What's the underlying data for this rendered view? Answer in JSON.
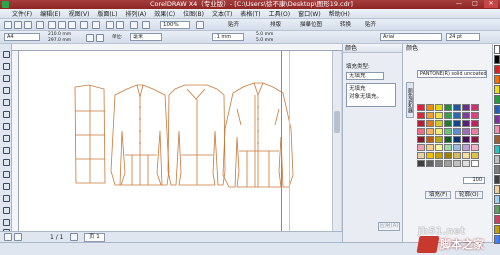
{
  "window": {
    "title": "CorelDRAW X4（专业版）- [C:\\Users\\徐不康\\Desktop\\图形19.cdr]",
    "controls": [
      "—",
      "□",
      "✕"
    ]
  },
  "menu": [
    "文件(F)",
    "编辑(E)",
    "视图(V)",
    "版面(L)",
    "排列(A)",
    "效果(C)",
    "位图(B)",
    "文本(T)",
    "表格(T)",
    "工具(O)",
    "窗口(W)",
    "帮助(H)"
  ],
  "toolbar": {
    "zoom": "100%",
    "snap_label": "贴齐",
    "options_label": "排版",
    "transform_label": "转换",
    "trace_label": "描摹位图",
    "paste_label": "贴齐"
  },
  "property_bar": {
    "page_size": "A4",
    "width": "210.0 mm",
    "height": "297.0 mm",
    "units_label": "单位:",
    "units": "毫米",
    "nudge": ".1 mm",
    "dup_x": "5.0 mm",
    "dup_y": "5.0 mm",
    "font": "Arial",
    "font_size": "24 pt"
  },
  "statusbar": {
    "page_counter": "1 / 1",
    "page_tab": "页 1"
  },
  "docker": {
    "title": "颜色",
    "fill_type_label": "填充类型:",
    "fill_type_value": "无填充",
    "info_lines": [
      "无填充",
      "对象无填充。"
    ],
    "apply_button": "应用(A)"
  },
  "color_panel": {
    "title": "颜色",
    "palette_select": "PANTONE(R) solid uncoated",
    "vertical_tab": "颜色调和器",
    "swatches": [
      "#e61e3c",
      "#f08a00",
      "#e8d800",
      "#2a8c3c",
      "#1a58a8",
      "#6a2e8c",
      "#d0306e",
      "#d8283c",
      "#f0a030",
      "#f0e040",
      "#3aa04c",
      "#2a68b8",
      "#7c3e9c",
      "#e0407e",
      "#b81e34",
      "#e07820",
      "#d8c820",
      "#1e7c34",
      "#0e4898",
      "#5a1e7c",
      "#c0205e",
      "#f06c84",
      "#f4b460",
      "#f4ec70",
      "#6cc47c",
      "#5a8cd8",
      "#9c6ebc",
      "#f07ca4",
      "#8c1428",
      "#c05a10",
      "#b8a810",
      "#145c24",
      "#083478",
      "#42105c",
      "#901444",
      "#f0a0b0",
      "#f8d090",
      "#f8f4a0",
      "#a0dca8",
      "#9cbce8",
      "#c0a0d8",
      "#f8b0c8",
      "#e8d0a0",
      "#f0c000",
      "#c8a000",
      "#a08000",
      "#d8b860",
      "#f4e0a0",
      "#e0c040",
      "#404040",
      "#606060",
      "#808080",
      "#a0a0a0",
      "#c0c0c0",
      "#e0e0e0",
      "#ffffff"
    ],
    "number": "100",
    "fill_button": "填充(F)",
    "outline_button": "轮廓(O)"
  },
  "palette_strip": [
    "#ffffff",
    "#000000",
    "#e02020",
    "#f07000",
    "#f0e000",
    "#20a040",
    "#2060c0",
    "#8030a0",
    "#f090b0",
    "#a06030",
    "#30c0c0",
    "#c0c0c0",
    "#808080",
    "#404040",
    "#f0d0a0",
    "#a0d0f0",
    "#60a060",
    "#d04060",
    "#c0a000",
    "#4080ff"
  ],
  "watermark": {
    "site": "jb51.net",
    "name": "脚本之家"
  }
}
